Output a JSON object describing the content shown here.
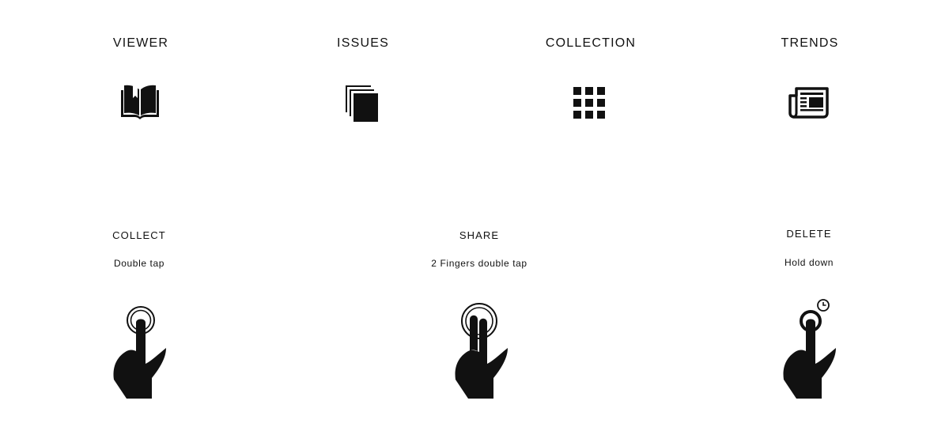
{
  "navigation": [
    {
      "label": "VIEWER",
      "icon": "open-book-icon"
    },
    {
      "label": "ISSUES",
      "icon": "stacked-pages-icon"
    },
    {
      "label": "COLLECTION",
      "icon": "grid-icon"
    },
    {
      "label": "TRENDS",
      "icon": "newspaper-icon"
    }
  ],
  "gestures": [
    {
      "title": "COLLECT",
      "description": "Double tap",
      "icon": "one-finger-tap-icon"
    },
    {
      "title": "SHARE",
      "description": "2 Fingers double tap",
      "icon": "two-finger-tap-icon"
    },
    {
      "title": "DELETE",
      "description": "Hold down",
      "icon": "finger-hold-icon"
    }
  ],
  "colors": {
    "ink": "#111111",
    "background": "#ffffff"
  }
}
